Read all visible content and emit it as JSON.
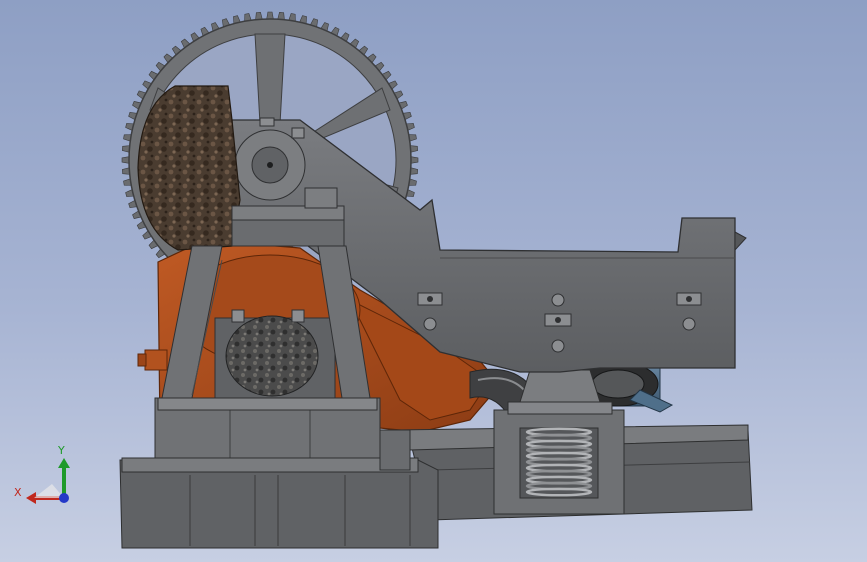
{
  "triad": {
    "x_label": "X",
    "y_label": "Y",
    "x_color": "#c0281e",
    "y_color": "#1e9a2a",
    "z_color": "#2438c8"
  },
  "palette": {
    "background_top": "#8e9fc4",
    "background_bottom": "#c7cfe3",
    "steel": "#6e7073",
    "steel_light": "#8a8c8f",
    "steel_dark": "#3c3d3f",
    "casting": "#b2521f",
    "casting_dark": "#7a3412",
    "motor": "#4f6f8a",
    "stone": "#5a4a3a"
  },
  "components": [
    "large-spur-gear",
    "crusher-jaw-frame",
    "flywheel-housing",
    "drive-motor",
    "bearing-block",
    "support-stand",
    "base-frame",
    "spring-support",
    "feed-chute"
  ]
}
